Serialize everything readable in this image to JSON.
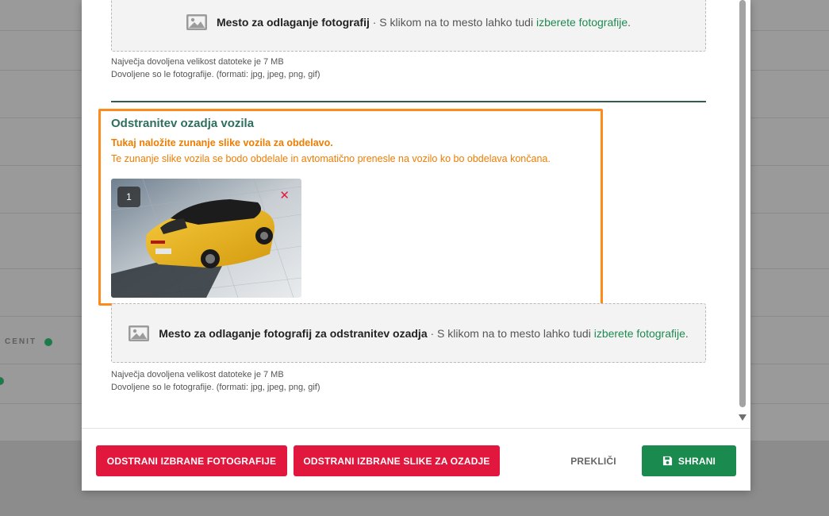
{
  "upload_top": {
    "title": "Mesto za odlaganje fotografij",
    "separator": " · S klikom na to mesto lahko tudi ",
    "link": "izberete fotografije",
    "end": ".",
    "hint_size": "Največja dovoljena velikost datoteke je 7 MB",
    "hint_formats": "Dovoljene so le fotografije. (formati: jpg, jpeg, png, gif)"
  },
  "background_removal": {
    "title": "Odstranitev ozadja vozila",
    "note_bold": "Tukaj naložite zunanje slike vozila za obdelavo.",
    "note": "Te zunanje slike vozila se bodo obdelale in avtomatično prenesle na vozilo ko bo obdelava končana.",
    "thumbnail": {
      "index": "1",
      "close": "✕"
    }
  },
  "upload_bottom": {
    "title": "Mesto za odlaganje fotografij za odstranitev ozadja",
    "separator": " · S klikom na to mesto lahko tudi ",
    "link": "izberete fotografije",
    "end": ".",
    "hint_size": "Največja dovoljena velikost datoteke je 7 MB",
    "hint_formats": "Dovoljene so le fotografije. (formati: jpg, jpeg, png, gif)"
  },
  "footer": {
    "remove_photos": "ODSTRANI IZBRANE FOTOGRAFIJE",
    "remove_bg_images": "ODSTRANI IZBRANE SLIKE ZA OZADJE",
    "cancel": "PREKLIČI",
    "save": "SHRANI"
  },
  "background": {
    "label": "CENIT"
  },
  "colors": {
    "accent_green": "#1a8a4e",
    "danger_red": "#e2173e",
    "highlight_orange": "#ff8a1c",
    "title_teal": "#2f6e5e"
  }
}
